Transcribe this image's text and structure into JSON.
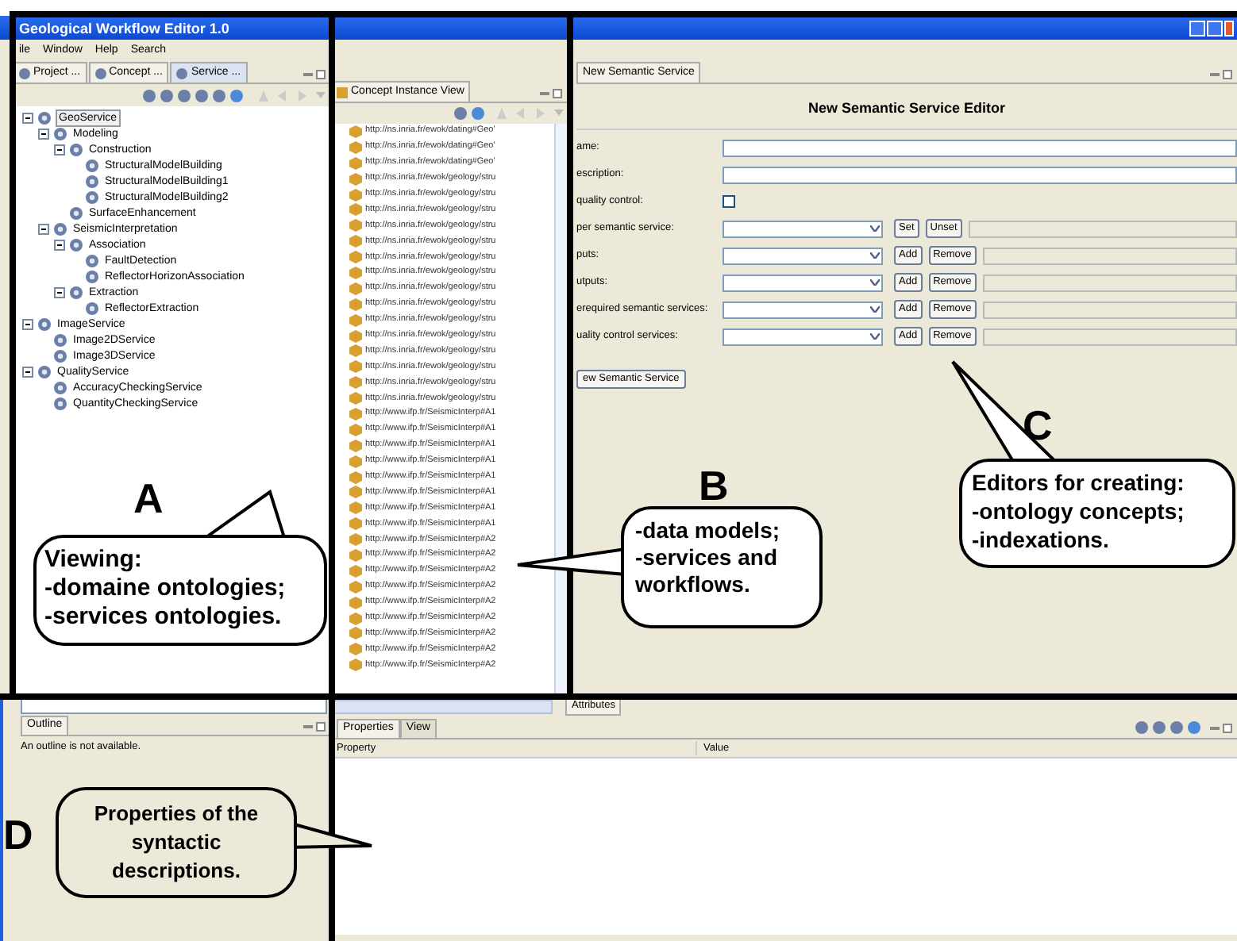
{
  "window": {
    "title": "Geological Workflow Editor 1.0"
  },
  "menu": [
    "ile",
    "Window",
    "Help",
    "Search"
  ],
  "service_panel": {
    "tabs": [
      {
        "label": "Project ...",
        "selected": false
      },
      {
        "label": "Concept ...",
        "selected": false
      },
      {
        "label": "Service ...",
        "selected": true
      }
    ],
    "tree": [
      {
        "label": "GeoService",
        "selected": true,
        "expanded": true,
        "children": [
          {
            "label": "Modeling",
            "selected": false,
            "expanded": true,
            "children": [
              {
                "label": "Construction",
                "selected": false,
                "expanded": true,
                "children": [
                  {
                    "label": "StructuralModelBuilding",
                    "selected": false
                  },
                  {
                    "label": "StructuralModelBuilding1",
                    "selected": false
                  },
                  {
                    "label": "StructuralModelBuilding2",
                    "selected": false
                  }
                ]
              },
              {
                "label": "SurfaceEnhancement",
                "selected": false
              }
            ]
          },
          {
            "label": "SeismicInterpretation",
            "selected": false,
            "expanded": true,
            "children": [
              {
                "label": "Association",
                "selected": false,
                "expanded": true,
                "children": [
                  {
                    "label": "FaultDetection",
                    "selected": false
                  },
                  {
                    "label": "ReflectorHorizonAssociation",
                    "selected": false
                  }
                ]
              },
              {
                "label": "Extraction",
                "selected": false,
                "expanded": true,
                "children": [
                  {
                    "label": "ReflectorExtraction",
                    "selected": false
                  }
                ]
              }
            ]
          }
        ]
      },
      {
        "label": "ImageService",
        "selected": false,
        "expanded": true,
        "children": [
          {
            "label": "Image2DService",
            "selected": false
          },
          {
            "label": "Image3DService",
            "selected": false
          }
        ]
      },
      {
        "label": "QualityService",
        "selected": false,
        "expanded": true,
        "children": [
          {
            "label": "AccuracyCheckingService",
            "selected": false
          },
          {
            "label": "QuantityCheckingService",
            "selected": false
          }
        ]
      }
    ]
  },
  "concept_view": {
    "tab": "Concept Instance View",
    "items": [
      "http://ns.inria.fr/ewok/dating#Geo'",
      "http://ns.inria.fr/ewok/dating#Geo'",
      "http://ns.inria.fr/ewok/dating#Geo'",
      "http://ns.inria.fr/ewok/geology/stru",
      "http://ns.inria.fr/ewok/geology/stru",
      "http://ns.inria.fr/ewok/geology/stru",
      "http://ns.inria.fr/ewok/geology/stru",
      "http://ns.inria.fr/ewok/geology/stru",
      "http://ns.inria.fr/ewok/geology/stru",
      "http://ns.inria.fr/ewok/geology/stru",
      "http://ns.inria.fr/ewok/geology/stru",
      "http://ns.inria.fr/ewok/geology/stru",
      "http://ns.inria.fr/ewok/geology/stru",
      "http://ns.inria.fr/ewok/geology/stru",
      "http://ns.inria.fr/ewok/geology/stru",
      "http://ns.inria.fr/ewok/geology/stru",
      "http://ns.inria.fr/ewok/geology/stru",
      "http://ns.inria.fr/ewok/geology/stru",
      "http://www.ifp.fr/SeismicInterp#A1",
      "http://www.ifp.fr/SeismicInterp#A1",
      "http://www.ifp.fr/SeismicInterp#A1",
      "http://www.ifp.fr/SeismicInterp#A1",
      "http://www.ifp.fr/SeismicInterp#A1",
      "http://www.ifp.fr/SeismicInterp#A1",
      "http://www.ifp.fr/SeismicInterp#A1",
      "http://www.ifp.fr/SeismicInterp#A1",
      "http://www.ifp.fr/SeismicInterp#A2",
      "http://www.ifp.fr/SeismicInterp#A2",
      "http://www.ifp.fr/SeismicInterp#A2",
      "http://www.ifp.fr/SeismicInterp#A2",
      "http://www.ifp.fr/SeismicInterp#A2",
      "http://www.ifp.fr/SeismicInterp#A2",
      "http://www.ifp.fr/SeismicInterp#A2",
      "http://www.ifp.fr/SeismicInterp#A2",
      "http://www.ifp.fr/SeismicInterp#A2"
    ]
  },
  "editor": {
    "tab": "New Semantic Service",
    "title": "New Semantic Service Editor",
    "fields": [
      {
        "kind": "text",
        "label": "ame:"
      },
      {
        "kind": "text",
        "label": "escription:"
      },
      {
        "kind": "checkbox",
        "label": "quality control:",
        "checked": false
      },
      {
        "kind": "combo",
        "label": "per semantic service:",
        "buttons": [
          "Set",
          "Unset"
        ]
      },
      {
        "kind": "combo",
        "label": "puts:",
        "buttons": [
          "Add",
          "Remove"
        ]
      },
      {
        "kind": "combo",
        "label": "utputs:",
        "buttons": [
          "Add",
          "Remove"
        ]
      },
      {
        "kind": "combo",
        "label": "erequired semantic services:",
        "buttons": [
          "Add",
          "Remove"
        ]
      },
      {
        "kind": "combo",
        "label": "uality control services:",
        "buttons": [
          "Add",
          "Remove"
        ]
      }
    ],
    "submit": "ew Semantic Service"
  },
  "attributes_tab": "Attributes",
  "outline": {
    "tab": "Outline",
    "message": "An outline is not available."
  },
  "properties": {
    "tabs": [
      {
        "label": "Properties",
        "selected": true
      },
      {
        "label": "View",
        "selected": false
      }
    ],
    "columns": [
      "Property",
      "Value"
    ]
  },
  "callouts": [
    {
      "letter": "A",
      "lines": [
        "Viewing:",
        "-domaine ontologies;",
        "-services ontologies."
      ]
    },
    {
      "letter": "B",
      "lines": [
        "-data models;",
        "-services and",
        "workflows."
      ]
    },
    {
      "letter": "C",
      "lines": [
        "Editors for creating:",
        "-ontology concepts;",
        "-indexations."
      ]
    },
    {
      "letter": "D",
      "lines": [
        "Properties of the",
        "syntactic",
        "descriptions."
      ]
    }
  ]
}
